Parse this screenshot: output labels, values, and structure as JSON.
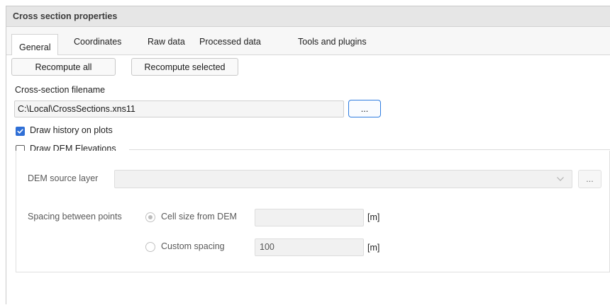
{
  "panel": {
    "title": "Cross section properties"
  },
  "tabs": [
    {
      "label": "General",
      "active": true
    },
    {
      "label": "Coordinates",
      "active": false
    },
    {
      "label": "Raw data",
      "active": false
    },
    {
      "label": "Processed data",
      "active": false
    },
    {
      "label": "Tools and plugins",
      "active": false
    }
  ],
  "general": {
    "recompute_all": "Recompute all",
    "recompute_selected": "Recompute selected",
    "filename_label": "Cross-section filename",
    "filename_value": "C:\\Local\\CrossSections.xns11",
    "browse_label": "...",
    "draw_history": {
      "label": "Draw history on plots",
      "checked": true
    },
    "draw_dem": {
      "label": "Draw DEM Elevations",
      "checked": false
    }
  },
  "dem": {
    "source_label": "DEM source layer",
    "source_value": "",
    "browse_label": "...",
    "spacing_label": "Spacing between points",
    "options": [
      {
        "label": "Cell size from DEM",
        "selected": true,
        "value": "",
        "unit": "[m]"
      },
      {
        "label": "Custom spacing",
        "selected": false,
        "value": "100",
        "unit": "[m]"
      }
    ]
  },
  "colors": {
    "accent": "#2f6fd6",
    "focus_border": "#2f7de0"
  }
}
